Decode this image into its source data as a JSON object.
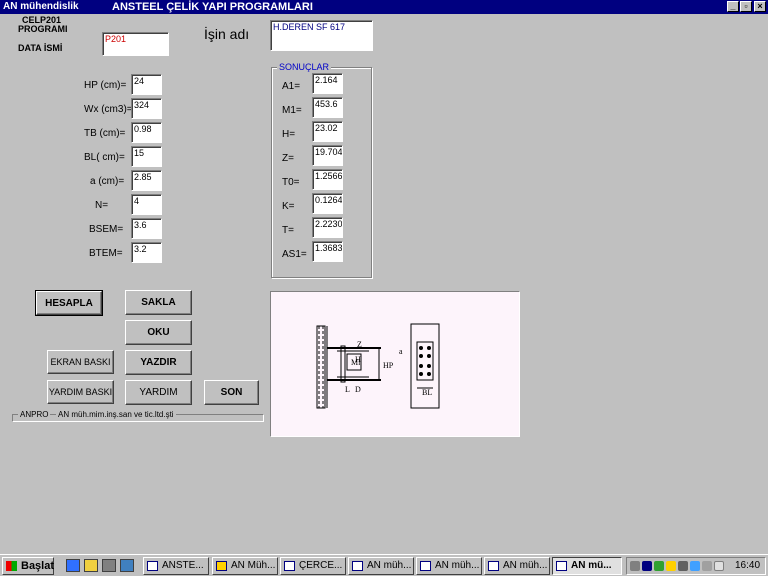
{
  "window": {
    "app_name": "AN mühendislik",
    "title": "ANSTEEL ÇELİK YAPI  PROGRAMLARI",
    "minimize": "_",
    "maximize": "▫",
    "close": "×"
  },
  "header": {
    "program_line1": "CELP201",
    "program_line2": "PROGRAMI",
    "data_label": "DATA İSMİ",
    "data_value": "P201",
    "job_label": "İşin adı",
    "job_value": "H.DEREN SF 617"
  },
  "inputs": [
    {
      "label": "HP (cm)=",
      "value": "24"
    },
    {
      "label": "Wx (cm3)=",
      "value": "324"
    },
    {
      "label": "TB (cm)=",
      "value": "0.98"
    },
    {
      "label": "BL( cm)=",
      "value": "15"
    },
    {
      "label": "a (cm)=",
      "value": "2.85"
    },
    {
      "label": "N=",
      "value": "4"
    },
    {
      "label": "BSEM=",
      "value": "3.6"
    },
    {
      "label": "BTEM=",
      "value": "3.2"
    }
  ],
  "results": {
    "title": "SONUÇLAR",
    "items": [
      {
        "label": "A1=",
        "value": "2.164"
      },
      {
        "label": "M1=",
        "value": "453.6"
      },
      {
        "label": "H=",
        "value": "23.02"
      },
      {
        "label": "Z=",
        "value": "19.704"
      },
      {
        "label": "T0=",
        "value": "1.2566"
      },
      {
        "label": "K=",
        "value": "0.1264"
      },
      {
        "label": "T=",
        "value": "2.2230"
      },
      {
        "label": "AS1=",
        "value": "1.3683"
      }
    ]
  },
  "buttons": {
    "hesapla": "HESAPLA",
    "sakla": "SAKLA",
    "oku": "OKU",
    "ekran_baski": "EKRAN BASKI",
    "yazdir": "YAZDIR",
    "yardim_baski": "YARDIM BASKI",
    "yardim": "YARDIM",
    "son": "SON"
  },
  "status": {
    "brand": "ANPRO",
    "company": "AN müh.mim.inş.san ve tic.ltd.şti"
  },
  "diagram": {
    "label_z": "Z",
    "label_h": "H",
    "label_ml": "Ml",
    "label_hp": "HP",
    "label_l": "L",
    "label_d": "D",
    "label_a": "a",
    "label_bl": "BL"
  },
  "taskbar": {
    "start": "Başlat",
    "tasks": [
      {
        "label": "ANSTE..."
      },
      {
        "label": "AN Müh..."
      },
      {
        "label": "ÇERCE..."
      },
      {
        "label": "AN müh..."
      },
      {
        "label": "AN müh..."
      },
      {
        "label": "AN müh..."
      },
      {
        "label": "AN mü..."
      }
    ],
    "clock": "16:40"
  },
  "colors": {
    "titlebar": "#000080",
    "face": "#c0c0c0",
    "group_title": "#0000c8",
    "data_value": "#cc0000",
    "job_value": "#000080"
  }
}
